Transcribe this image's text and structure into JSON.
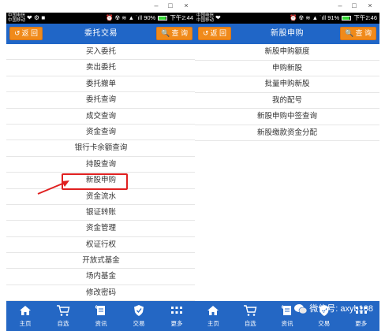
{
  "left": {
    "status": {
      "carrier_top": "中国电信",
      "carrier_bottom": "中国移动",
      "signal_icons": "❤ ⚙ ■",
      "status_icons": "⏰ ☢ ≋ ▲ ˙ıll",
      "battery_pct": "90%",
      "battery_level": 0.9,
      "time": "下午2:44"
    },
    "header": {
      "back_label": "返 回",
      "title": "委托交易",
      "search_label": "查 询"
    },
    "menu": [
      "买入委托",
      "卖出委托",
      "委托撤单",
      "委托查询",
      "成交查询",
      "资金查询",
      "银行卡余额查询",
      "持股查询",
      "新股申购",
      "资金流水",
      "银证转账",
      "资金管理",
      "权证行权",
      "开放式基金",
      "场内基金",
      "修改密码"
    ]
  },
  "right": {
    "status": {
      "carrier_top": "中国电信",
      "carrier_bottom": "中国移动",
      "signal_icons": "❤",
      "status_icons": "⏰ ☢ ≋ ▲ ˙ıll",
      "battery_pct": "91%",
      "battery_level": 0.91,
      "time": "下午2:46"
    },
    "header": {
      "back_label": "返 回",
      "title": "新股申购",
      "search_label": "查 询"
    },
    "menu": [
      "新股申购额度",
      "申购新股",
      "批量申购新股",
      "我的配号",
      "新股申购中签查询",
      "新股缴款资金分配"
    ]
  },
  "window_controls": {
    "minimize": "–",
    "maximize": "□",
    "close": "×"
  },
  "tabbar": [
    {
      "label": "主页",
      "icon": "home-icon"
    },
    {
      "label": "自选",
      "icon": "cart-icon"
    },
    {
      "label": "资讯",
      "icon": "news-icon"
    },
    {
      "label": "交易",
      "icon": "shield-icon"
    },
    {
      "label": "更多",
      "icon": "grid-icon"
    }
  ],
  "watermark": "微信号: axyb108",
  "colors": {
    "header": "#2066c7",
    "button": "#f08a1a",
    "highlight": "#e02020",
    "tabbar": "#2467c4"
  }
}
